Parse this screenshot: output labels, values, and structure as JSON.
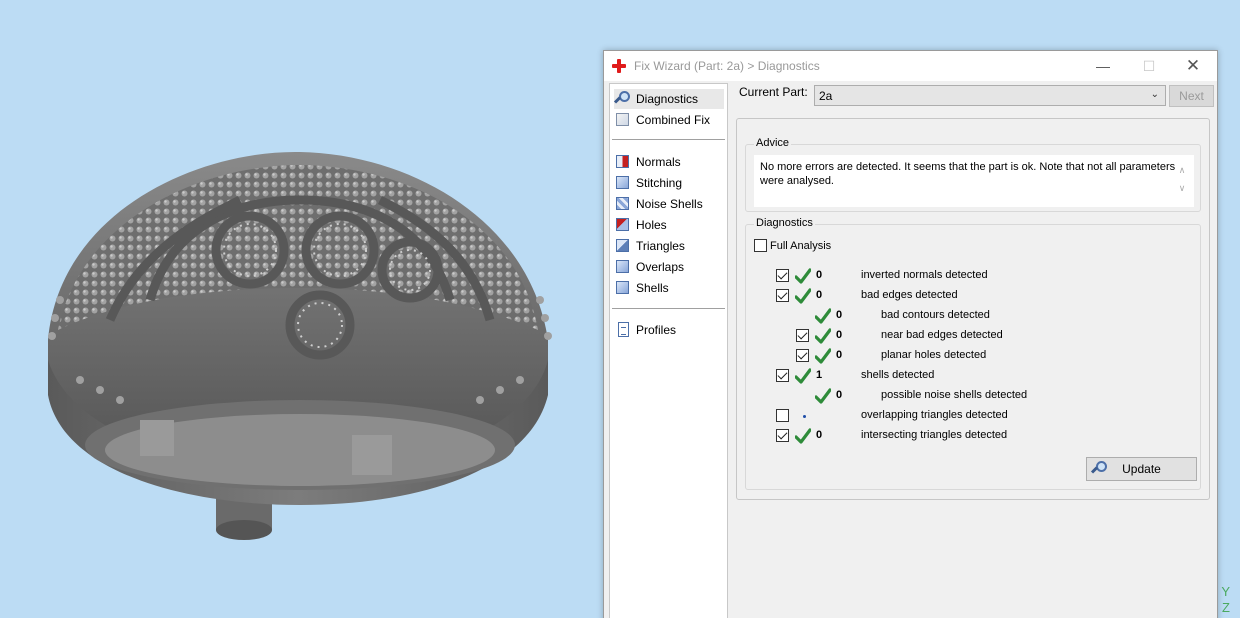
{
  "viewport": {
    "axis_labels": [
      "Y",
      "Z"
    ]
  },
  "window": {
    "title": "Fix Wizard (Part: 2a) > Diagnostics",
    "controls": {
      "minimize": "—",
      "maximize": "☐",
      "close": "✕"
    }
  },
  "nav": {
    "items": [
      {
        "label": "Diagnostics",
        "icon": "magnifier-icon",
        "selected": true
      },
      {
        "label": "Combined Fix",
        "icon": "cube-icon"
      },
      {
        "label": "Normals",
        "icon": "normals-cube-icon"
      },
      {
        "label": "Stitching",
        "icon": "stitching-cube-icon"
      },
      {
        "label": "Noise Shells",
        "icon": "noise-shells-icon"
      },
      {
        "label": "Holes",
        "icon": "holes-cube-icon"
      },
      {
        "label": "Triangles",
        "icon": "triangles-cube-icon"
      },
      {
        "label": "Overlaps",
        "icon": "overlaps-cube-icon"
      },
      {
        "label": "Shells",
        "icon": "shells-cube-icon"
      },
      {
        "label": "Profiles",
        "icon": "document-icon"
      }
    ]
  },
  "current_part": {
    "label": "Current Part:",
    "value": "2a",
    "next_label": "Next"
  },
  "advice": {
    "title": "Advice",
    "text": "No more errors are detected. It seems that the part is ok. Note that not all parameters were analysed."
  },
  "diagnostics": {
    "title": "Diagnostics",
    "full_analysis_label": "Full Analysis",
    "rows": [
      {
        "checkbox": true,
        "checked": true,
        "status": "ok",
        "count": "0",
        "label": "inverted normals detected",
        "indent": 0
      },
      {
        "checkbox": true,
        "checked": true,
        "status": "ok",
        "count": "0",
        "label": "bad edges detected",
        "indent": 0
      },
      {
        "checkbox": false,
        "checked": false,
        "status": "ok",
        "count": "0",
        "label": "bad contours detected",
        "indent": 1
      },
      {
        "checkbox": true,
        "checked": true,
        "status": "ok",
        "count": "0",
        "label": "near bad edges detected",
        "indent": 1
      },
      {
        "checkbox": true,
        "checked": true,
        "status": "ok",
        "count": "0",
        "label": "planar holes detected",
        "indent": 1
      },
      {
        "checkbox": true,
        "checked": true,
        "status": "ok",
        "count": "1",
        "label": "shells detected",
        "indent": 0
      },
      {
        "checkbox": false,
        "checked": false,
        "status": "ok",
        "count": "0",
        "label": "possible noise shells detected",
        "indent": 1
      },
      {
        "checkbox": true,
        "checked": false,
        "status": "none",
        "count": "",
        "label": "overlapping triangles detected",
        "indent": 0
      },
      {
        "checkbox": true,
        "checked": true,
        "status": "ok",
        "count": "0",
        "label": "intersecting triangles detected",
        "indent": 0
      }
    ],
    "update_label": "Update"
  },
  "colors": {
    "background": "#bcdcf4",
    "check_green": "#2e8b3a",
    "app_red": "#e01b1b"
  }
}
